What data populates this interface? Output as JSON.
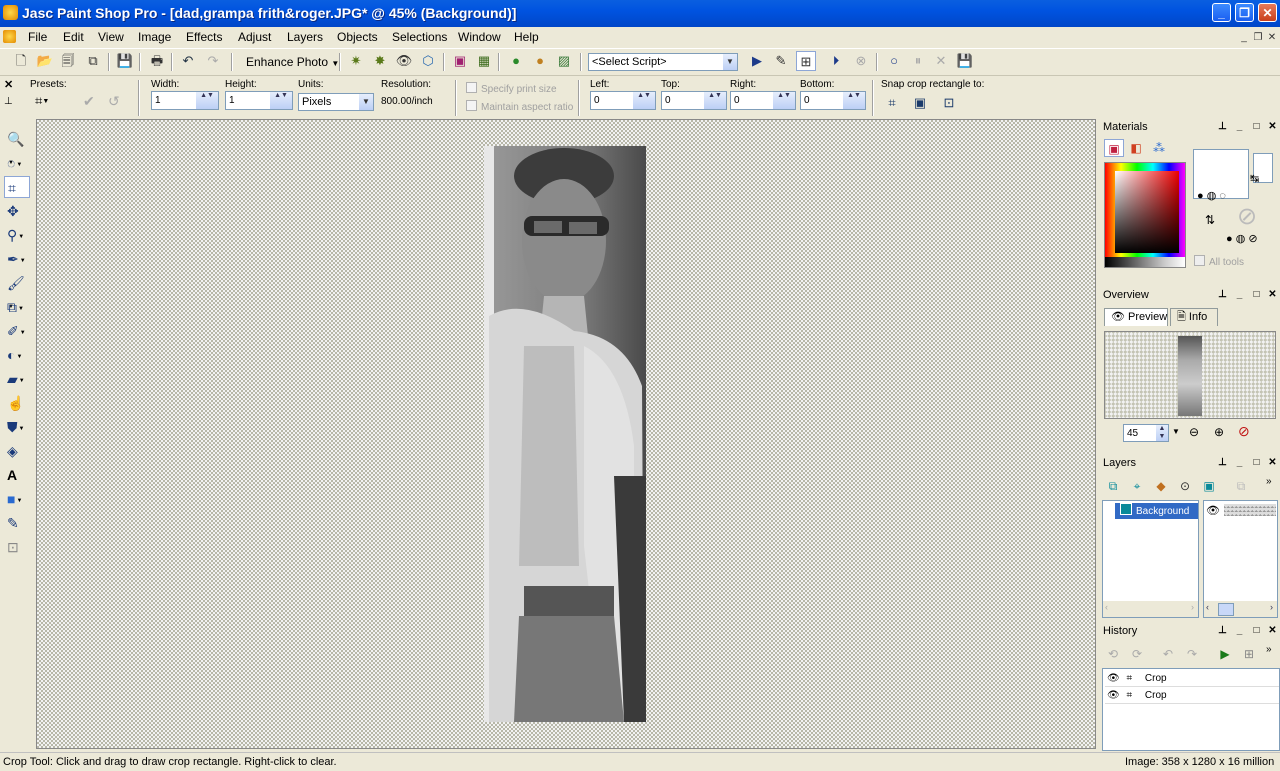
{
  "window": {
    "title": "Jasc Paint Shop Pro - [dad,grampa frith&roger.JPG* @  45% (Background)]",
    "minimize": "_",
    "maximize": "❐",
    "close": "✕"
  },
  "menu": [
    "File",
    "Edit",
    "View",
    "Image",
    "Effects",
    "Adjust",
    "Layers",
    "Objects",
    "Selections",
    "Window",
    "Help"
  ],
  "mdi_controls": [
    "_",
    "❐",
    "✕"
  ],
  "toolbar": {
    "enhance_photo_label": "Enhance Photo",
    "script_combo_value": "<Select Script>"
  },
  "crop_options": {
    "presets_label": "Presets:",
    "width_label": "Width:",
    "width_value": "1",
    "height_label": "Height:",
    "height_value": "1",
    "units_label": "Units:",
    "units_value": "Pixels",
    "resolution_label": "Resolution:",
    "resolution_value": "800.00/inch",
    "specify_print_size": "Specify print size",
    "maintain_aspect_ratio": "Maintain aspect ratio",
    "left_label": "Left:",
    "left_value": "0",
    "top_label": "Top:",
    "top_value": "0",
    "right_label": "Right:",
    "right_value": "0",
    "bottom_label": "Bottom:",
    "bottom_value": "0",
    "snap_label": "Snap crop rectangle to:"
  },
  "materials": {
    "title": "Materials",
    "all_tools_label": "All tools"
  },
  "overview": {
    "title": "Overview",
    "tab_preview": "Preview",
    "tab_info": "Info",
    "zoom_value": "45"
  },
  "layers": {
    "title": "Layers",
    "items": [
      {
        "name": "Background"
      }
    ]
  },
  "history": {
    "title": "History",
    "items": [
      {
        "label": "Crop"
      },
      {
        "label": "Crop"
      }
    ]
  },
  "status": {
    "message": "Crop Tool: Click and drag to draw crop rectangle. Right-click to clear.",
    "image_info": "Image:  358 x 1280 x 16 million"
  }
}
